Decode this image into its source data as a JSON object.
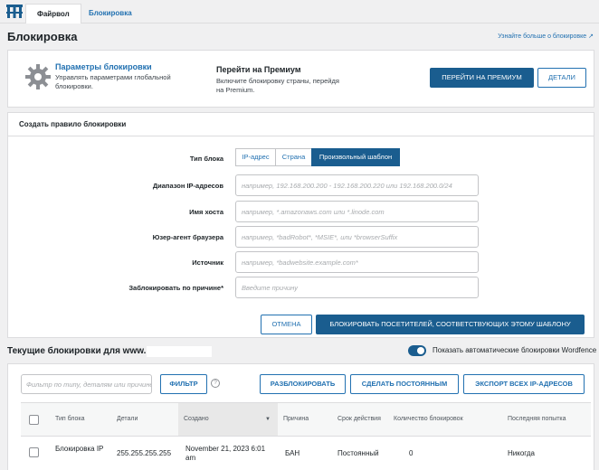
{
  "tabs": [
    {
      "label": "Файрвол",
      "active": true
    },
    {
      "label": "Блокировка",
      "active": false
    }
  ],
  "page": {
    "title": "Блокировка",
    "learn_more": "Узнайте больше о блокировке"
  },
  "params_card": {
    "title": "Параметры блокировки",
    "desc": "Управлять параметрами глобальной блокировки.",
    "premium_title": "Перейти на Премиум",
    "premium_desc": "Включите блокировку страны, перейдя на Premium.",
    "premium_button": "ПЕРЕЙТИ НА ПРЕМИУМ",
    "details_button": "ДЕТАЛИ"
  },
  "rule_form": {
    "title": "Создать правило блокировки",
    "block_type_label": "Тип блока",
    "block_types": [
      "IP-адрес",
      "Страна",
      "Произвольный шаблон"
    ],
    "selected_type": "Произвольный шаблон",
    "fields": [
      {
        "label": "Диапазон IP-адресов",
        "placeholder": "например, 192.168.200.200 - 192.168.200.220 или 192.168.200.0/24"
      },
      {
        "label": "Имя хоста",
        "placeholder": "например, *.amazonaws.com или *.linode.com"
      },
      {
        "label": "Юзер-агент браузера",
        "placeholder": "например, *badRobot*, *MSIE*, или *browserSuffix"
      },
      {
        "label": "Источник",
        "placeholder": "например, *badwebsite.example.com*"
      },
      {
        "label": "Заблокировать по причине*",
        "placeholder": "Введите причину"
      }
    ],
    "cancel_button": "ОТМЕНА",
    "block_button": "БЛОКИРОВАТЬ ПОСЕТИТЕЛЕЙ, СООТВЕТСТВУЮЩИХ ЭТОМУ ШАБЛОНУ"
  },
  "current_blocks": {
    "title": "Текущие блокировки для www.",
    "toggle_label": "Показать автоматические блокировки Wordfence",
    "toggle_on": true,
    "filter_placeholder": "Фильтр по типу, деталям или причине",
    "filter_button": "ФИЛЬТР",
    "help_icon": "?",
    "unblock_button": "РАЗБЛОКИРОВАТЬ",
    "permanent_button": "СДЕЛАТЬ ПОСТОЯННЫМ",
    "export_button": "ЭКСПОРТ ВСЕХ IP-АДРЕСОВ",
    "columns": [
      "Тип блока",
      "Детали",
      "Создано",
      "Причина",
      "Срок действия",
      "Количество блокировок",
      "Последняя попытка"
    ],
    "rows": [
      {
        "type": "Блокировка IP",
        "details": "255.255.255.255",
        "created": "November 21, 2023 6:01 am",
        "reason": "БАН",
        "expiry": "Постоянный",
        "count": "0",
        "last": "Никогда"
      }
    ]
  },
  "colors": {
    "accent": "#1a5d8f",
    "link": "#2271b1",
    "background": "#f0f0f1"
  }
}
